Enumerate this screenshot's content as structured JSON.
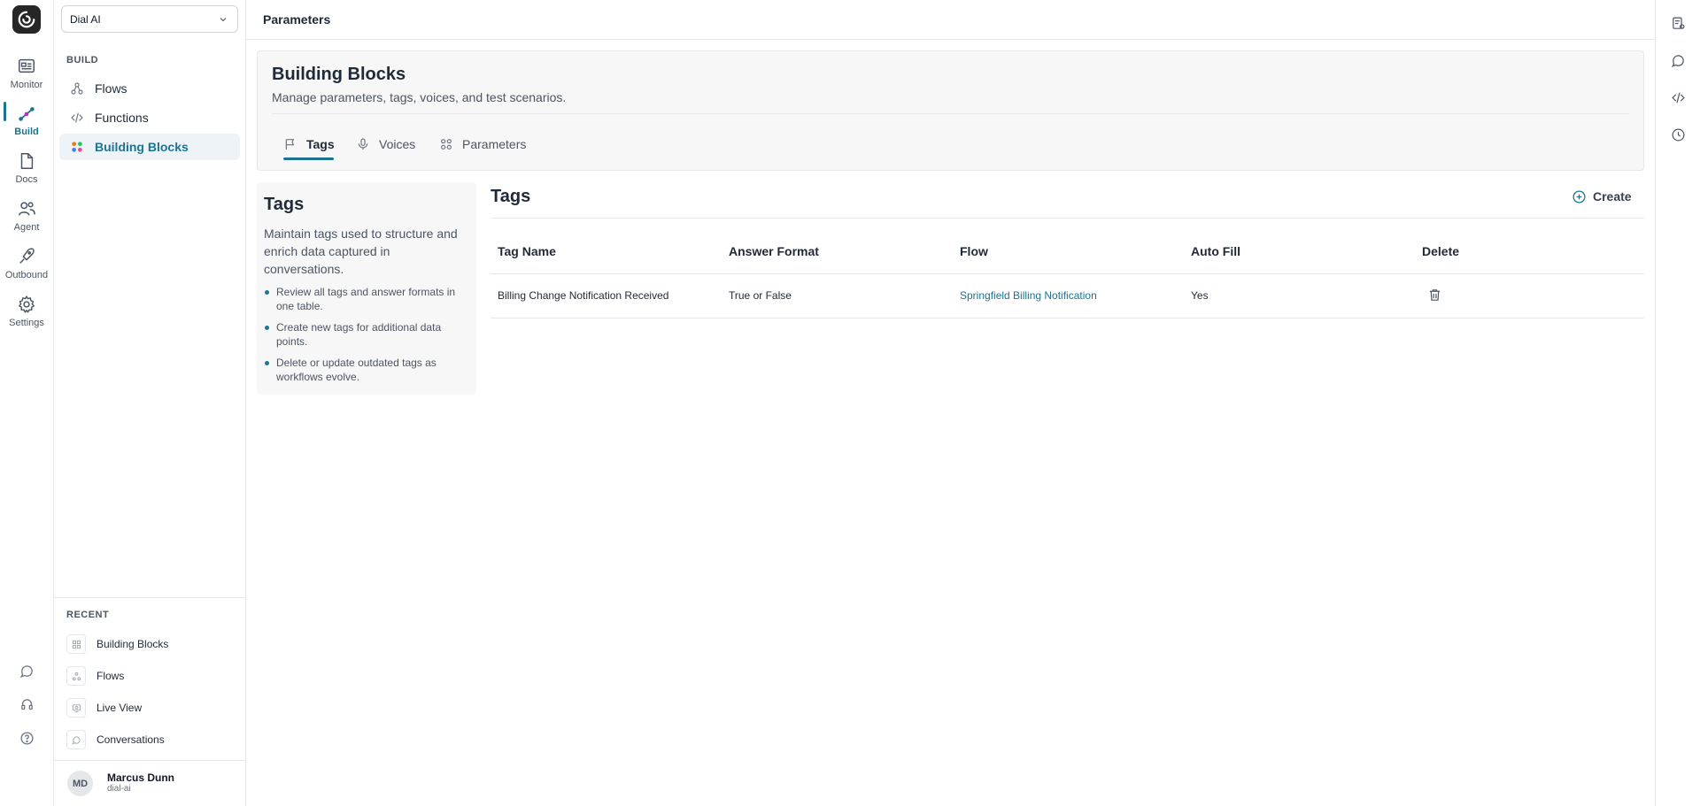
{
  "rail": {
    "items": [
      {
        "label": "Monitor",
        "icon": "monitor-icon"
      },
      {
        "label": "Build",
        "icon": "build-icon"
      },
      {
        "label": "Docs",
        "icon": "docs-icon"
      },
      {
        "label": "Agent",
        "icon": "agent-icon"
      },
      {
        "label": "Outbound",
        "icon": "outbound-icon"
      },
      {
        "label": "Settings",
        "icon": "gear-icon"
      }
    ],
    "active": "Build",
    "accent_color": "#1c7491"
  },
  "sidebar": {
    "workspace": "Dial AI",
    "build_section": "BUILD",
    "items": [
      {
        "label": "Flows",
        "icon": "flows-icon"
      },
      {
        "label": "Functions",
        "icon": "code-icon"
      },
      {
        "label": "Building Blocks",
        "icon": "blocks-icon"
      }
    ],
    "active": "Building Blocks",
    "recent_section": "RECENT",
    "recent": [
      {
        "label": "Building Blocks"
      },
      {
        "label": "Flows"
      },
      {
        "label": "Live View"
      },
      {
        "label": "Conversations"
      }
    ],
    "user": {
      "initials": "MD",
      "name": "Marcus Dunn",
      "org": "dial-ai"
    }
  },
  "header": {
    "title": "Parameters"
  },
  "building_blocks": {
    "title": "Building Blocks",
    "subtitle": "Manage parameters, tags, voices, and test scenarios.",
    "tabs": [
      {
        "label": "Tags",
        "icon": "flag-icon"
      },
      {
        "label": "Voices",
        "icon": "mic-icon"
      },
      {
        "label": "Parameters",
        "icon": "grid-icon"
      }
    ],
    "active_tab": "Tags"
  },
  "info": {
    "title": "Tags",
    "description": "Maintain tags used to structure and enrich data captured in conversations.",
    "bullets": [
      "Review all tags and answer formats in one table.",
      "Create new tags for additional data points.",
      "Delete or update outdated tags as workflows evolve."
    ]
  },
  "tags_table": {
    "title": "Tags",
    "create_label": "Create",
    "columns": [
      "Tag Name",
      "Answer Format",
      "Flow",
      "Auto Fill",
      "Delete"
    ],
    "rows": [
      {
        "tag_name": "Billing Change Notification Received",
        "answer_format": "True or False",
        "flow": "Springfield Billing Notification",
        "auto_fill": "Yes"
      }
    ]
  }
}
